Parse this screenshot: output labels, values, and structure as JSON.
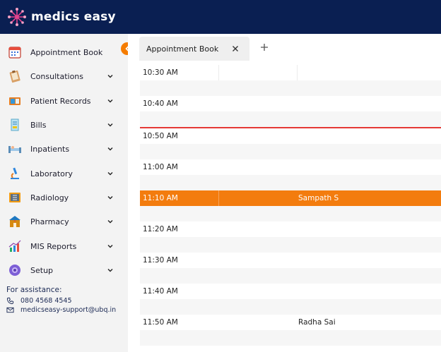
{
  "app": {
    "brand": "medics easy"
  },
  "sidebar": {
    "items": [
      {
        "label": "Appointment Book",
        "icon": "calendar-icon",
        "has_submenu": false
      },
      {
        "label": "Consultations",
        "icon": "notepad-icon",
        "has_submenu": true
      },
      {
        "label": "Patient Records",
        "icon": "folder-icon",
        "has_submenu": true
      },
      {
        "label": "Bills",
        "icon": "invoice-icon",
        "has_submenu": true
      },
      {
        "label": "Inpatients",
        "icon": "bed-icon",
        "has_submenu": true
      },
      {
        "label": "Laboratory",
        "icon": "microscope-icon",
        "has_submenu": true
      },
      {
        "label": "Radiology",
        "icon": "xray-icon",
        "has_submenu": true
      },
      {
        "label": "Pharmacy",
        "icon": "pharmacy-icon",
        "has_submenu": true
      },
      {
        "label": "MIS Reports",
        "icon": "chart-icon",
        "has_submenu": true
      },
      {
        "label": "Setup",
        "icon": "gear-icon",
        "has_submenu": true
      }
    ],
    "assistance": {
      "title": "For assistance:",
      "phone": "080 4568 4545",
      "email": "medicseasy-support@ubq.in"
    }
  },
  "tabs": [
    {
      "label": "Appointment Book"
    }
  ],
  "schedule": {
    "rows": [
      {
        "time": "10:30 AM",
        "patient": ""
      },
      {
        "time": "",
        "patient": ""
      },
      {
        "time": "10:40 AM",
        "patient": ""
      },
      {
        "time": "",
        "patient": ""
      },
      {
        "time": "10:50 AM",
        "patient": ""
      },
      {
        "time": "",
        "patient": ""
      },
      {
        "time": "11:00 AM",
        "patient": ""
      },
      {
        "time": "",
        "patient": ""
      },
      {
        "time": "11:10 AM",
        "patient": "Sampath S",
        "highlighted": true
      },
      {
        "time": "",
        "patient": ""
      },
      {
        "time": "11:20 AM",
        "patient": ""
      },
      {
        "time": "",
        "patient": ""
      },
      {
        "time": "11:30 AM",
        "patient": ""
      },
      {
        "time": "",
        "patient": ""
      },
      {
        "time": "11:40 AM",
        "patient": ""
      },
      {
        "time": "",
        "patient": ""
      },
      {
        "time": "11:50 AM",
        "patient": "Radha Sai"
      },
      {
        "time": "",
        "patient": ""
      }
    ]
  },
  "colors": {
    "header": "#0a1f52",
    "accent": "#f37c0e",
    "current_time_line": "#e53935"
  }
}
